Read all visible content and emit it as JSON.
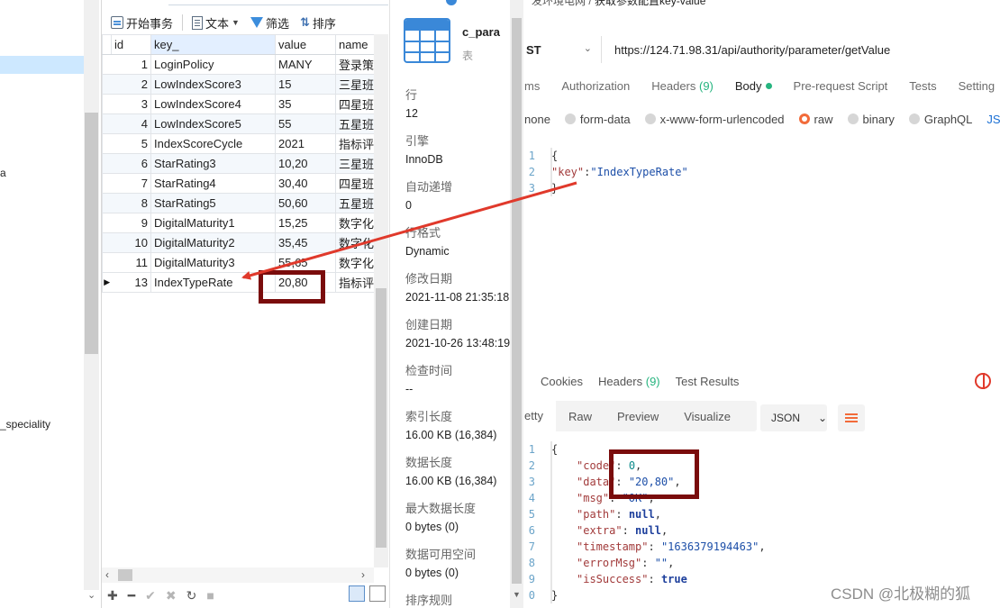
{
  "tree": {
    "truncated_item": "_speciality"
  },
  "navicat": {
    "tab_label": "获取参数配置key-value",
    "toolbar": {
      "begin_tx": "开始事务",
      "text": "文本",
      "filter": "筛选",
      "sort": "排序"
    },
    "columns": [
      "id",
      "key_",
      "value",
      "name"
    ],
    "rows": [
      {
        "id": "1",
        "key": "LoginPolicy",
        "value": "MANY",
        "name": "登录策略"
      },
      {
        "id": "2",
        "key": "LowIndexScore3",
        "value": "15",
        "name": "三星班组"
      },
      {
        "id": "3",
        "key": "LowIndexScore4",
        "value": "35",
        "name": "四星班组"
      },
      {
        "id": "4",
        "key": "LowIndexScore5",
        "value": "55",
        "name": "五星班组"
      },
      {
        "id": "5",
        "key": "IndexScoreCycle",
        "value": "2021",
        "name": "指标评分"
      },
      {
        "id": "6",
        "key": "StarRating3",
        "value": "10,20",
        "name": "三星班组"
      },
      {
        "id": "7",
        "key": "StarRating4",
        "value": "30,40",
        "name": "四星班组"
      },
      {
        "id": "8",
        "key": "StarRating5",
        "value": "50,60",
        "name": "五星班组"
      },
      {
        "id": "9",
        "key": "DigitalMaturity1",
        "value": "15,25",
        "name": "数字化成"
      },
      {
        "id": "10",
        "key": "DigitalMaturity2",
        "value": "35,45",
        "name": "数字化成"
      },
      {
        "id": "11",
        "key": "DigitalMaturity3",
        "value": "55,65",
        "name": "数字化成"
      },
      {
        "id": "13",
        "key": "IndexTypeRate",
        "value": "20,80",
        "name": "指标评分"
      }
    ],
    "selected_row": "13"
  },
  "info": {
    "table_name": "c_para",
    "table_type": "表",
    "fields": [
      {
        "label": "行",
        "value": "12"
      },
      {
        "label": "引擎",
        "value": "InnoDB"
      },
      {
        "label": "自动递增",
        "value": "0"
      },
      {
        "label": "行格式",
        "value": "Dynamic"
      },
      {
        "label": "修改日期",
        "value": "2021-11-08 21:35:18"
      },
      {
        "label": "创建日期",
        "value": "2021-10-26 13:48:19"
      },
      {
        "label": "检查时间",
        "value": "--"
      },
      {
        "label": "索引长度",
        "value": "16.00 KB (16,384)"
      },
      {
        "label": "数据长度",
        "value": "16.00 KB (16,384)"
      },
      {
        "label": "最大数据长度",
        "value": "0 bytes (0)"
      },
      {
        "label": "数据可用空间",
        "value": "0 bytes (0)"
      },
      {
        "label": "排序规则",
        "value": ""
      }
    ]
  },
  "postman": {
    "breadcrumb_env": "发环境电网",
    "breadcrumb_sep": "/",
    "breadcrumb_name": "获取参数配置key-value",
    "method": "ST",
    "url": "https://124.71.98.31/api/authority/parameter/getValue",
    "req_tabs": {
      "params": "ms",
      "authorization": "Authorization",
      "headers": "Headers",
      "headers_count": "(9)",
      "body": "Body",
      "prerequest": "Pre-request Script",
      "tests": "Tests",
      "settings": "Setting"
    },
    "body_opts": {
      "none": "none",
      "form_data": "form-data",
      "urlencoded": "x-www-form-urlencoded",
      "raw": "raw",
      "binary": "binary",
      "graphql": "GraphQL",
      "json": "JS"
    },
    "request_lines": [
      "1",
      "2",
      "3"
    ],
    "request_body": {
      "open": "{",
      "key": "\"key\"",
      "colon": ":",
      "value": "\"IndexTypeRate\"",
      "close": "}"
    },
    "resp_tabs": {
      "cookies": "Cookies",
      "headers": "Headers",
      "headers_count": "(9)",
      "test_results": "Test Results"
    },
    "format": {
      "pretty": "etty",
      "raw": "Raw",
      "preview": "Preview",
      "visualize": "Visualize",
      "lang": "JSON"
    },
    "response_lines": [
      "1",
      "2",
      "3",
      "4",
      "5",
      "6",
      "7",
      "8",
      "9",
      "0"
    ],
    "response": {
      "open": "{",
      "code_k": "\"code\"",
      "code_v": "0",
      "data_k": "\"data\"",
      "data_v": "\"20,80\"",
      "msg_k": "\"msg\"",
      "msg_v": "\"OK\"",
      "path_k": "\"path\"",
      "path_v": "null",
      "extra_k": "\"extra\"",
      "extra_v": "null",
      "ts_k": "\"timestamp\"",
      "ts_v": "\"1636379194463\"",
      "err_k": "\"errorMsg\"",
      "err_v": "\"\"",
      "succ_k": "\"isSuccess\"",
      "succ_v": "true",
      "close": "}"
    }
  },
  "watermark": "CSDN @北极糊的狐",
  "colors": {
    "annotation_box": "#7a0c0c",
    "annotation_arrow": "#e0392b",
    "postman_green": "#26b47f",
    "postman_orange": "#f26b3a"
  }
}
